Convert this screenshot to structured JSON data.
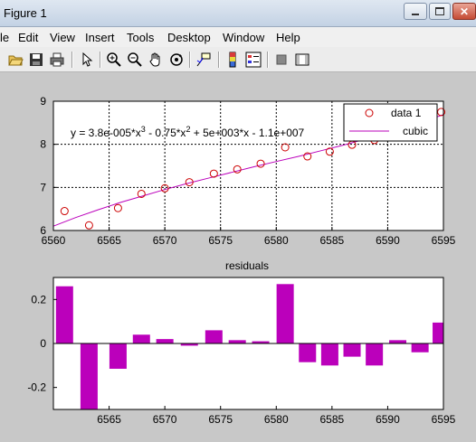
{
  "window": {
    "title": "Figure 1"
  },
  "menu": [
    "le",
    "Edit",
    "View",
    "Insert",
    "Tools",
    "Desktop",
    "Window",
    "Help"
  ],
  "toolbar": [
    "folder-open",
    "save",
    "print",
    "pointer",
    "zoom-in",
    "zoom-out",
    "pan-hand",
    "rotate-3d",
    "data-cursor",
    "colorbar",
    "legend",
    "hide-plot-tools",
    "show-plot-tools"
  ],
  "colors": {
    "data": "#cc0000",
    "fit": "#bb00bb",
    "bars": "#bb00bb"
  },
  "chart_data": [
    {
      "type": "scatter",
      "series": [
        {
          "name": "data 1",
          "marker": "circle",
          "x": [
            6561,
            6563.2,
            6565.8,
            6567.9,
            6570,
            6572.2,
            6574.4,
            6576.5,
            6578.6,
            6580.8,
            6582.8,
            6584.8,
            6586.8,
            6588.8,
            6590.9,
            6592.9,
            6594.8
          ],
          "y": [
            6.45,
            6.12,
            6.52,
            6.85,
            6.98,
            7.12,
            7.32,
            7.42,
            7.55,
            7.93,
            7.72,
            7.83,
            7.99,
            8.1,
            8.3,
            8.55,
            8.75
          ]
        },
        {
          "name": "cubic",
          "type": "line",
          "x": [
            6560,
            6562,
            6564,
            6566,
            6568,
            6570,
            6572,
            6574,
            6576,
            6578,
            6580,
            6582,
            6584,
            6586,
            6588,
            6590,
            6592,
            6594,
            6595
          ],
          "y": [
            6.1,
            6.3,
            6.48,
            6.65,
            6.8,
            6.95,
            7.09,
            7.22,
            7.35,
            7.48,
            7.6,
            7.72,
            7.85,
            7.98,
            8.12,
            8.27,
            8.43,
            8.6,
            8.69
          ]
        }
      ],
      "xlim": [
        6560,
        6595
      ],
      "ylim": [
        6,
        9
      ],
      "xticks": [
        "6560",
        "6565",
        "6570",
        "6575",
        "6580",
        "6585",
        "6590",
        "6595"
      ],
      "yticks": [
        "6",
        "7",
        "8",
        "9"
      ],
      "grid": true,
      "legend_position": "top-right",
      "annotation": {
        "text": "y = 3.8e-005*x",
        "sup1": "3",
        "mid": " - 0.75*x",
        "sup2": "2",
        "end": " + 5e+003*x - 1.1e+007"
      }
    },
    {
      "type": "bar",
      "title": "residuals",
      "x": [
        6561,
        6563.2,
        6565.8,
        6567.9,
        6570,
        6572.2,
        6574.4,
        6576.5,
        6578.6,
        6580.8,
        6582.8,
        6584.8,
        6586.8,
        6588.8,
        6590.9,
        6592.9,
        6594.8
      ],
      "values": [
        0.26,
        -0.31,
        -0.115,
        0.04,
        0.02,
        -0.01,
        0.06,
        0.015,
        0.01,
        0.27,
        -0.085,
        -0.1,
        -0.06,
        -0.1,
        0.015,
        -0.04,
        0.095
      ],
      "xlim": [
        6560,
        6595
      ],
      "ylim": [
        -0.3,
        0.3
      ],
      "xticks": [
        "6565",
        "6570",
        "6575",
        "6580",
        "6585",
        "6590",
        "6595"
      ],
      "yticks": [
        "0.2",
        "0",
        "-0.2"
      ]
    }
  ]
}
